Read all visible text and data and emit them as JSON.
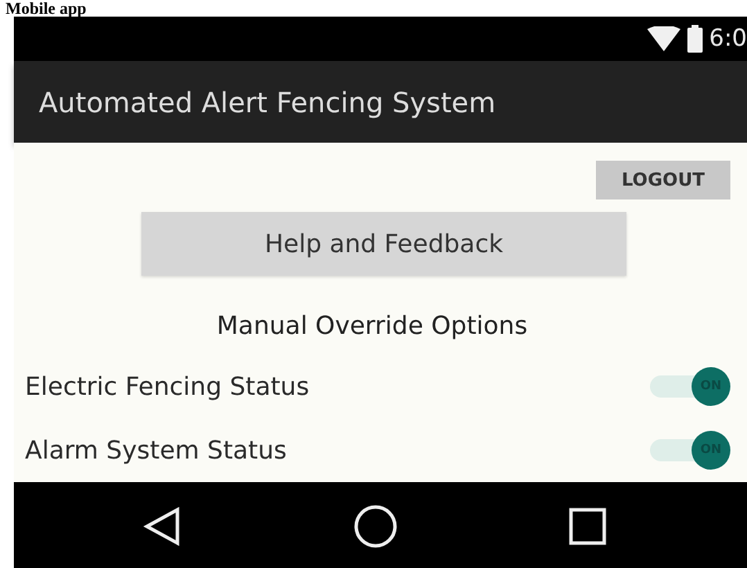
{
  "caption": "Mobile app",
  "status_bar": {
    "time": "6:0"
  },
  "app_bar": {
    "title": "Automated Alert Fencing System"
  },
  "logout_button": "LOGOUT",
  "help_button": "Help and Feedback",
  "section_title": "Manual Override Options",
  "settings": [
    {
      "label": "Electric Fencing Status",
      "on": true,
      "toggle_text": "ON"
    },
    {
      "label": "Alarm System Status",
      "on": true,
      "toggle_text": "ON"
    }
  ]
}
